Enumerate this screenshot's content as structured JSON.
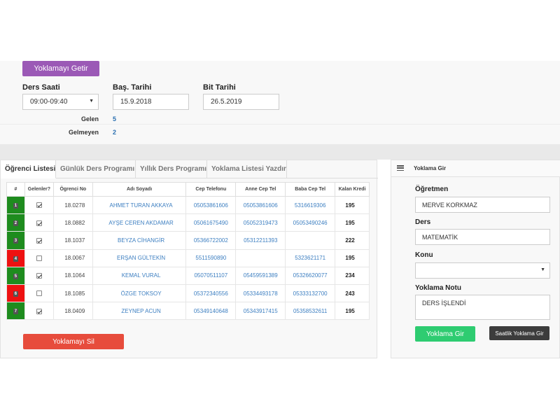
{
  "toolbar": {
    "getir_label": "Yoklamayı Getir"
  },
  "filters": {
    "ders_saati_label": "Ders Saati",
    "ders_saati_value": "09:00-09:40",
    "bas_tarihi_label": "Baş. Tarihi",
    "bas_tarihi_value": "15.9.2018",
    "bit_tarihi_label": "Bit Tarihi",
    "bit_tarihi_value": "26.5.2019"
  },
  "stats": {
    "gelen_label": "Gelen",
    "gelen_value": "5",
    "gelmeyen_label": "Gelmeyen",
    "gelmeyen_value": "2"
  },
  "tabs": [
    {
      "label": "Öğrenci Listesi"
    },
    {
      "label": "Günlük Ders Programı"
    },
    {
      "label": "Yıllık Ders Programı"
    },
    {
      "label": "Yoklama Listesi Yazdır"
    }
  ],
  "table": {
    "headers": [
      "#",
      "Gelenler?",
      "Ögrenci No",
      "Adı Soyadı",
      "Cep Telefonu",
      "Anne Cep Tel",
      "Baba Cep Tel",
      "Kalan Kredi"
    ],
    "rows": [
      {
        "num": "1",
        "present": true,
        "no": "18.0278",
        "name": "AHMET TURAN AKKAYA",
        "cep": "05053861606",
        "anne": "05053861606",
        "baba": "5316619306",
        "kredi": "195"
      },
      {
        "num": "2",
        "present": true,
        "no": "18.0882",
        "name": "AYŞE CEREN AKDAMAR",
        "cep": "05061675490",
        "anne": "05052319473",
        "baba": "05053490246",
        "kredi": "195"
      },
      {
        "num": "3",
        "present": true,
        "no": "18.1037",
        "name": "BEYZA CİHANGİR",
        "cep": "05366722002",
        "anne": "05312211393",
        "baba": "",
        "kredi": "222"
      },
      {
        "num": "4",
        "present": false,
        "no": "18.0067",
        "name": "ERŞAN GÜLTEKİN",
        "cep": "5511590890",
        "anne": "",
        "baba": "5323621171",
        "kredi": "195"
      },
      {
        "num": "5",
        "present": true,
        "no": "18.1064",
        "name": "KEMAL VURAL",
        "cep": "05070511107",
        "anne": "05459591389",
        "baba": "05326620077",
        "kredi": "234"
      },
      {
        "num": "6",
        "present": false,
        "no": "18.1085",
        "name": "ÖZGE TOKSOY",
        "cep": "05372340556",
        "anne": "05334493178",
        "baba": "05333132700",
        "kredi": "243"
      },
      {
        "num": "7",
        "present": true,
        "no": "18.0409",
        "name": "ZEYNEP ACUN",
        "cep": "05349140648",
        "anne": "05343917415",
        "baba": "05358532611",
        "kredi": "195"
      }
    ]
  },
  "footer": {
    "sil_label": "Yoklamayı Sil"
  },
  "right_panel": {
    "title": "Yoklama Gir",
    "ogretmen_label": "Öğretmen",
    "ogretmen_value": "MERVE KORKMAZ",
    "ders_label": "Ders",
    "ders_value": "MATEMATİK",
    "konu_label": "Konu",
    "konu_value": "",
    "not_label": "Yoklama Notu",
    "not_value": "DERS İŞLENDİ",
    "gir_label": "Yoklama Gir",
    "saatlik_label": "Saatlik Yoklama Gir"
  },
  "colors": {
    "purple": "#9b59b6",
    "present_green": "#1e8c1e",
    "absent_red": "#ee1111",
    "delete_red": "#e74c3c",
    "save_green": "#2ecc71",
    "dark_button": "#3c3c3c",
    "link_blue": "#3d7fc1"
  }
}
